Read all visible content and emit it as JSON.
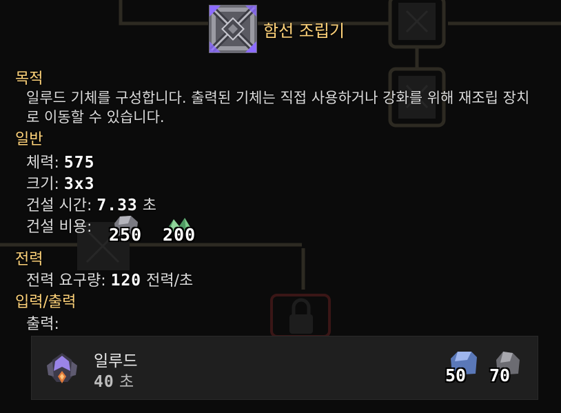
{
  "block": {
    "name": "함선 조립기",
    "icon": "assembler-block-icon"
  },
  "sections": {
    "purpose": {
      "title": "목적",
      "description": "일루드 기체를 구성합니다. 출력된 기체는 직접 사용하거나 강화를 위해 재조립 장치로 이동할 수 있습니다."
    },
    "general": {
      "title": "일반",
      "health_label": "체력:",
      "health_value": "575",
      "size_label": "크기:",
      "size_value": "3x3",
      "build_time_label": "건설 시간:",
      "build_time_value": "7.33",
      "build_time_unit": "초",
      "build_cost_label": "건설 비용:",
      "costs": [
        {
          "icon": "silicon-ore-icon",
          "amount": "250"
        },
        {
          "icon": "beryllium-green-icon",
          "amount": "200"
        }
      ]
    },
    "power": {
      "title": "전력",
      "usage_label": "전력 요구량:",
      "usage_value": "120",
      "usage_unit": "전력/초"
    },
    "io": {
      "title": "입력/출력",
      "output_label": "출력:"
    }
  },
  "output_unit": {
    "name": "일루드",
    "icon": "illude-unit-icon",
    "time_value": "40",
    "time_unit": "초",
    "costs": [
      {
        "icon": "blue-ore-icon",
        "amount": "50"
      },
      {
        "icon": "grey-ore-icon",
        "amount": "70"
      }
    ]
  },
  "colors": {
    "section_title": "#ffd37a",
    "accent_purple": "#8c6cff",
    "background": "#0b0b0b",
    "card": "#1f1f1f"
  }
}
